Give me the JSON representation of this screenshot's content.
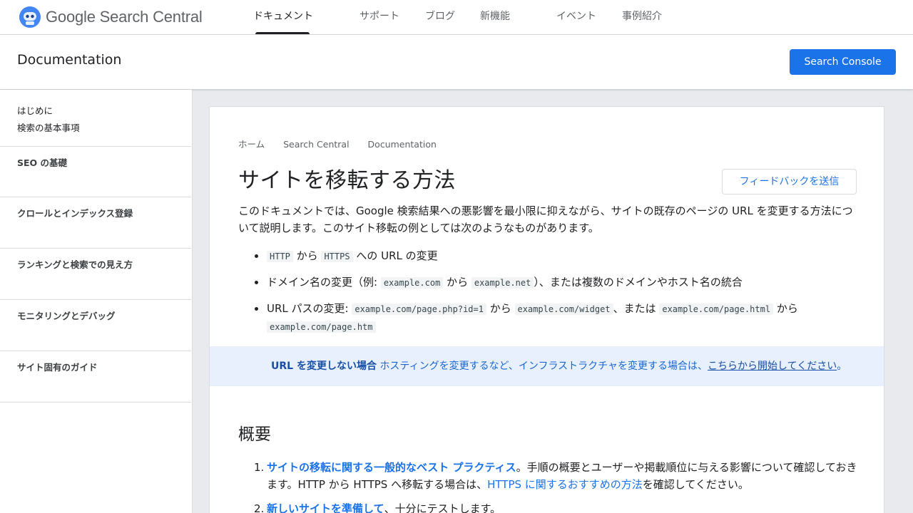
{
  "brand": {
    "name": "Google Search Central"
  },
  "nav": {
    "items": [
      {
        "label": "ドキュメント",
        "active": true
      },
      {
        "label": "サポート"
      },
      {
        "label": "ブログ"
      },
      {
        "label": "新機能"
      },
      {
        "label": "イベント"
      },
      {
        "label": "事例紹介"
      }
    ]
  },
  "subheader": {
    "title": "Documentation",
    "console_button": "Search Console"
  },
  "sidebar": {
    "intro": [
      "はじめに",
      "検索の基本事項"
    ],
    "sections": [
      "SEO の基礎",
      "クロールとインデックス登録",
      "ランキングと検索での見え方",
      "モニタリングとデバッグ",
      "サイト固有のガイド"
    ]
  },
  "content": {
    "breadcrumb": [
      "ホーム",
      "Search Central",
      "Documentation"
    ],
    "title": "サイトを移転する方法",
    "feedback_button": "フィードバックを送信",
    "intro": "このドキュメントでは、Google 検索結果への悪影響を最小限に抑えながら、サイトの既存のページの URL を変更する方法について説明します。このサイト移転の例としては次のようなものがあります。",
    "bullets": {
      "b1": {
        "code1": "HTTP",
        "t1": " から ",
        "code2": "HTTPS",
        "t2": " への URL の変更"
      },
      "b2": {
        "t0": "ドメイン名の変更（例: ",
        "code1": "example.com",
        "t1": " から ",
        "code2": "example.net",
        "t2": "）、または複数のドメインやホスト名の統合"
      },
      "b3": {
        "t0": "URL パスの変更: ",
        "code1": "example.com/page.php?id=1",
        "t1": " から ",
        "code2": "example.com/widget",
        "t2": "、または ",
        "code3": "example.com/page.html",
        "t3": " から ",
        "code4": "example.com/page.htm"
      }
    },
    "note": {
      "strong": "URL を変更しない場合",
      "text": " ホスティングを変更するなど、インフラストラクチャを変更する場合は、",
      "link": "こちらから開始してください",
      "end": "。"
    },
    "overview_heading": "概要",
    "steps": [
      {
        "num": "1.",
        "link": "サイトの移転に関する一般的なベスト プラクティス",
        "t1": "。手順の概要とユーザーや掲載順位に与える影響について確認しておきます。HTTP から HTTPS へ移転する場合は、",
        "link2": "HTTPS に関するおすすめの方法",
        "t2": "を確認してください。"
      },
      {
        "num": "2.",
        "link": "新しいサイトを準備して",
        "t1": "、十分にテストします。"
      }
    ]
  },
  "colors": {
    "accent": "#1a73e8",
    "note_bg": "#e8f0fe",
    "page_bg": "#e8eaed"
  }
}
